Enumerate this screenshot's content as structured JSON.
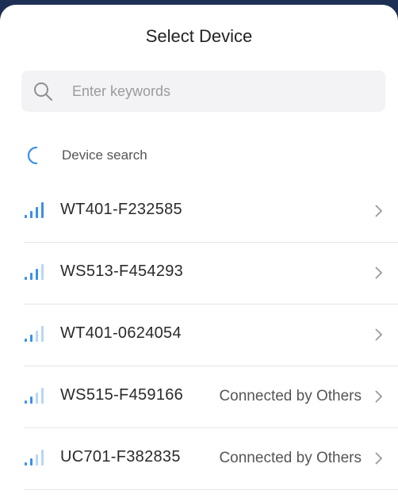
{
  "header": {
    "title": "Select Device"
  },
  "search": {
    "placeholder": "Enter keywords",
    "icon": "search-icon"
  },
  "scan": {
    "label": "Device search",
    "icon": "loading-spinner-icon",
    "accent": "#3b8fe8"
  },
  "colors": {
    "signal_active": "#3b8fe8",
    "signal_inactive": "#b8d6f5",
    "divider": "#e6e6e8"
  },
  "devices": [
    {
      "name": "WT401-F232585",
      "status": "",
      "signal_bars": 4
    },
    {
      "name": "WS513-F454293",
      "status": "",
      "signal_bars": 3
    },
    {
      "name": "WT401-0624054",
      "status": "",
      "signal_bars": 2
    },
    {
      "name": "WS515-F459166",
      "status": "Connected by Others",
      "signal_bars": 2
    },
    {
      "name": "UC701-F382835",
      "status": "Connected by Others",
      "signal_bars": 2
    }
  ]
}
